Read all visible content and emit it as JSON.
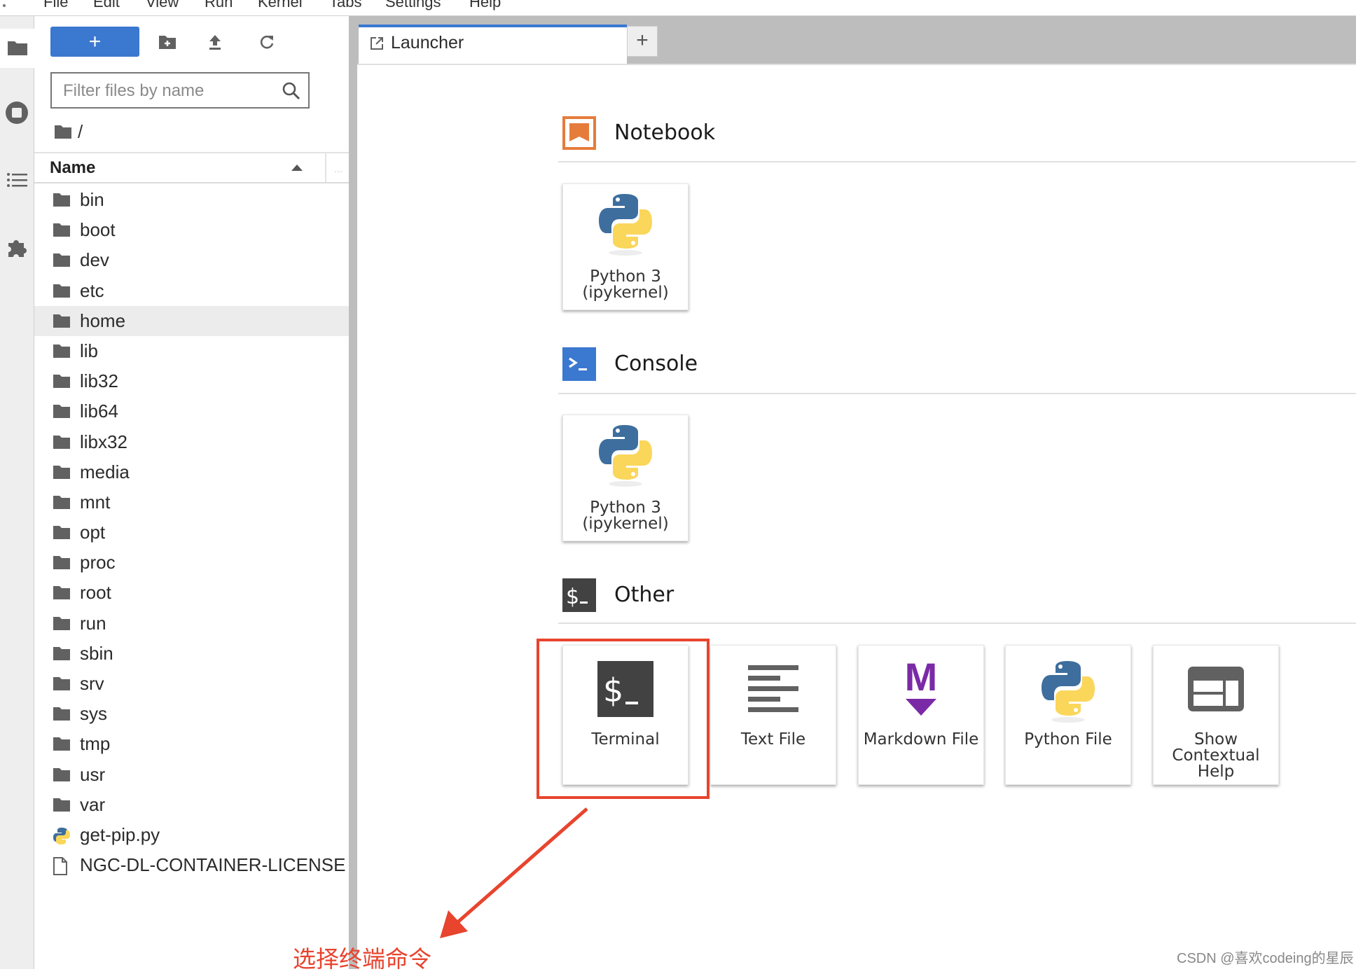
{
  "menubar": {
    "items": [
      "File",
      "Edit",
      "View",
      "Run",
      "Kernel",
      "Tabs",
      "Settings",
      "Help"
    ]
  },
  "iconbar": {
    "items": [
      {
        "name": "file-browser",
        "icon": "folder-icon",
        "active": true
      },
      {
        "name": "running-terminals-kernels",
        "icon": "stop-circle-icon"
      },
      {
        "name": "table-of-contents",
        "icon": "list-icon"
      },
      {
        "name": "extension-manager",
        "icon": "puzzle-icon"
      }
    ]
  },
  "sidebar": {
    "new_button_label": "+",
    "toolbar_icons": [
      "new-folder-icon",
      "upload-icon",
      "refresh-icon"
    ],
    "filter_placeholder": "Filter files by name",
    "filter_value": "",
    "breadcrumb": "/",
    "column_header": "Name",
    "column_more": "...",
    "files": [
      {
        "name": "bin",
        "type": "folder"
      },
      {
        "name": "boot",
        "type": "folder"
      },
      {
        "name": "dev",
        "type": "folder"
      },
      {
        "name": "etc",
        "type": "folder"
      },
      {
        "name": "home",
        "type": "folder",
        "selected": true
      },
      {
        "name": "lib",
        "type": "folder"
      },
      {
        "name": "lib32",
        "type": "folder"
      },
      {
        "name": "lib64",
        "type": "folder"
      },
      {
        "name": "libx32",
        "type": "folder"
      },
      {
        "name": "media",
        "type": "folder"
      },
      {
        "name": "mnt",
        "type": "folder"
      },
      {
        "name": "opt",
        "type": "folder"
      },
      {
        "name": "proc",
        "type": "folder"
      },
      {
        "name": "root",
        "type": "folder"
      },
      {
        "name": "run",
        "type": "folder"
      },
      {
        "name": "sbin",
        "type": "folder"
      },
      {
        "name": "srv",
        "type": "folder"
      },
      {
        "name": "sys",
        "type": "folder"
      },
      {
        "name": "tmp",
        "type": "folder"
      },
      {
        "name": "usr",
        "type": "folder"
      },
      {
        "name": "var",
        "type": "folder"
      },
      {
        "name": "get-pip.py",
        "type": "python"
      },
      {
        "name": "NGC-DL-CONTAINER-LICENSE",
        "type": "file"
      }
    ]
  },
  "tabs": {
    "items": [
      {
        "label": "Launcher",
        "icon": "launch-icon",
        "active": true
      }
    ],
    "add_label": "+"
  },
  "launcher": {
    "sections": [
      {
        "title": "Notebook",
        "icon": "notebook-icon",
        "cards": [
          {
            "label_line1": "Python 3",
            "label_line2": "(ipykernel)",
            "icon": "python-icon"
          }
        ]
      },
      {
        "title": "Console",
        "icon": "console-icon",
        "cards": [
          {
            "label_line1": "Python 3",
            "label_line2": "(ipykernel)",
            "icon": "python-icon"
          }
        ]
      },
      {
        "title": "Other",
        "icon": "terminal-icon",
        "cards": [
          {
            "label": "Terminal",
            "icon": "terminal-icon"
          },
          {
            "label": "Text File",
            "icon": "text-file-icon"
          },
          {
            "label": "Markdown File",
            "icon": "markdown-icon"
          },
          {
            "label": "Python File",
            "icon": "python-icon"
          },
          {
            "label_line1": "Show",
            "label_line2": "Contextual",
            "label_line3": "Help",
            "icon": "contextual-help-icon"
          }
        ]
      }
    ]
  },
  "annotation": {
    "text": "选择终端命令",
    "color": "#e8442e"
  },
  "watermark": "CSDN @喜欢codeing的星辰",
  "colors": {
    "accent": "#3b78d0",
    "notebook_orange": "#e67c3c",
    "markdown_purple": "#7b2aa7",
    "icon_gray": "#616161",
    "annotation_red": "#e8442e"
  }
}
